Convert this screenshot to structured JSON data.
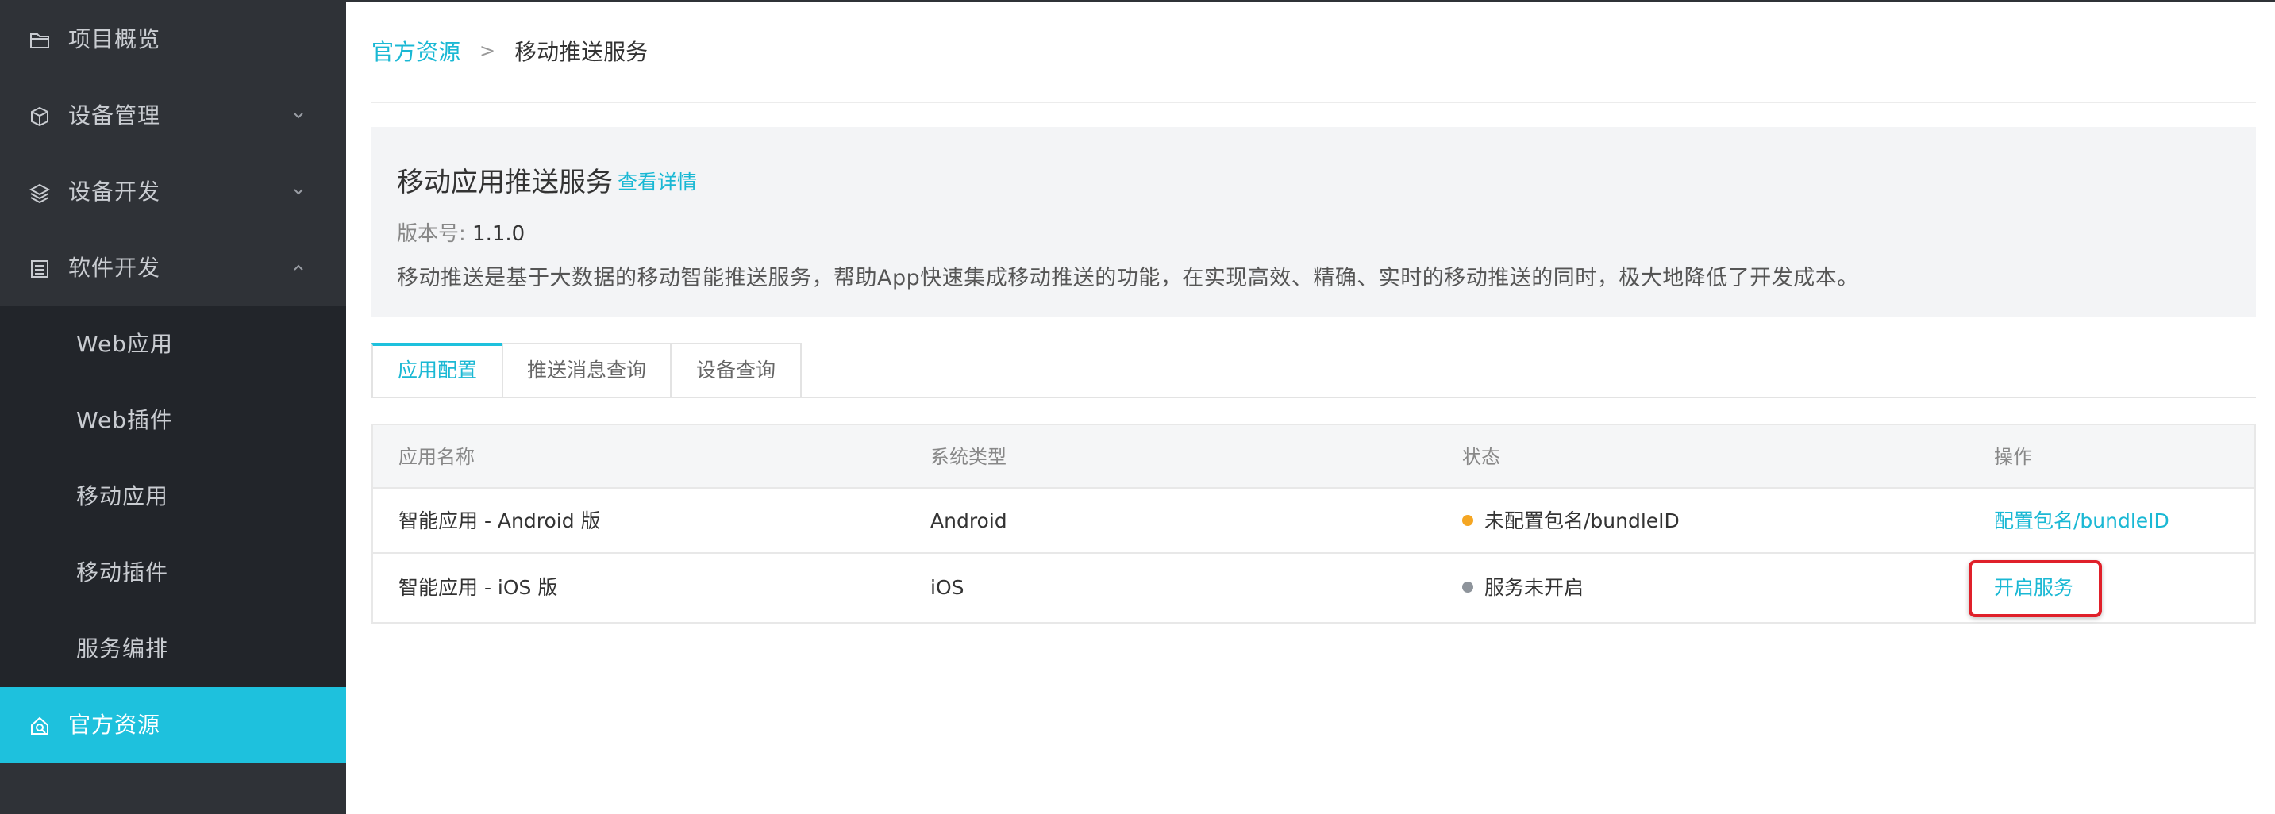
{
  "sidebar": {
    "items": [
      {
        "label": "项目概览",
        "icon": "folder-icon",
        "chevron": false
      },
      {
        "label": "设备管理",
        "icon": "cube-icon",
        "chevron": "down"
      },
      {
        "label": "设备开发",
        "icon": "layers-icon",
        "chevron": "down"
      },
      {
        "label": "软件开发",
        "icon": "list-icon",
        "chevron": "up"
      }
    ],
    "subitems": [
      {
        "label": "Web应用"
      },
      {
        "label": "Web插件"
      },
      {
        "label": "移动应用"
      },
      {
        "label": "移动插件"
      },
      {
        "label": "服务编排"
      }
    ],
    "active_item": {
      "label": "官方资源",
      "icon": "resource-icon"
    }
  },
  "breadcrumb": {
    "parent": "官方资源",
    "separator": ">",
    "current": "移动推送服务"
  },
  "info": {
    "title": "移动应用推送服务",
    "details_link": "查看详情",
    "version_label": "版本号:",
    "version_value": "1.1.0",
    "description": "移动推送是基于大数据的移动智能推送服务，帮助App快速集成移动推送的功能，在实现高效、精确、实时的移动推送的同时，极大地降低了开发成本。"
  },
  "tabs": [
    {
      "label": "应用配置",
      "active": true
    },
    {
      "label": "推送消息查询",
      "active": false
    },
    {
      "label": "设备查询",
      "active": false
    }
  ],
  "table": {
    "columns": [
      "应用名称",
      "系统类型",
      "状态",
      "操作"
    ],
    "rows": [
      {
        "name": "智能应用 - Android 版",
        "os": "Android",
        "status": "未配置包名/bundleID",
        "status_color": "#f5a623",
        "action": "配置包名/bundleID"
      },
      {
        "name": "智能应用 - iOS 版",
        "os": "iOS",
        "status": "服务未开启",
        "status_color": "#8e949b",
        "action": "开启服务"
      }
    ]
  },
  "colors": {
    "accent": "#1ec1dd",
    "sidebar_bg": "#2f3237",
    "highlight": "#e0202a"
  }
}
